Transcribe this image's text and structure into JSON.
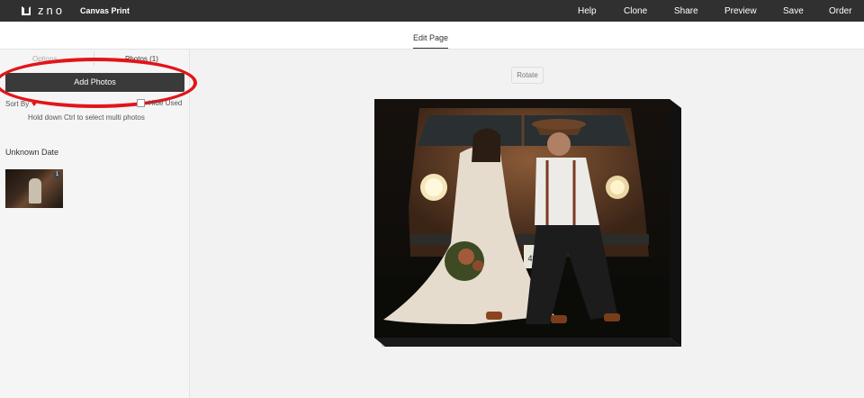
{
  "topbar": {
    "logo_text": "zno",
    "product_title": "Canvas Print",
    "nav": {
      "help": "Help",
      "clone": "Clone",
      "share": "Share",
      "preview": "Preview",
      "save": "Save",
      "order": "Order"
    }
  },
  "subbar": {
    "active_tab": "Edit Page"
  },
  "sidebar": {
    "tabs": {
      "options": "Options",
      "photos": "Photos (1)"
    },
    "add_photos_label": "Add Photos",
    "sort_by_label": "Sort By",
    "hide_used_label": "Hide Used",
    "hint": "Hold down Ctrl to select multi photos",
    "date_group": "Unknown Date",
    "photos": [
      {
        "usage_count": "1"
      }
    ]
  },
  "canvas": {
    "rotate_label": "Rotate",
    "license_plate": "494"
  },
  "colors": {
    "topbar": "#303030",
    "button": "#3a3a3a",
    "annotation": "#e2151a"
  }
}
